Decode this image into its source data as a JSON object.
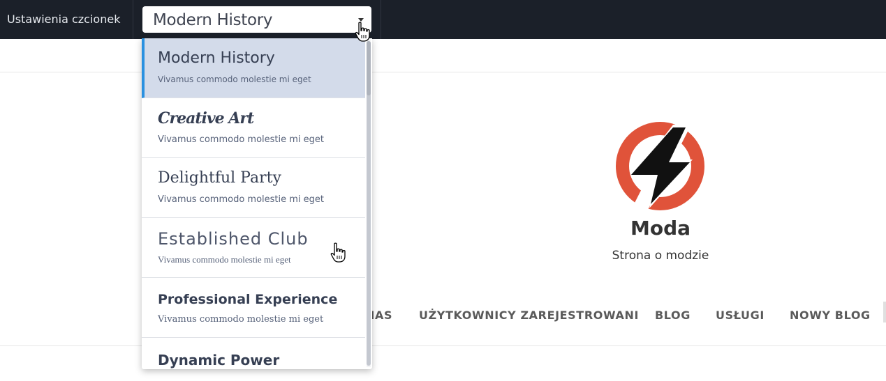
{
  "toolbar": {
    "label": "Ustawienia czcionek",
    "selected_font": "Modern History"
  },
  "dropdown": {
    "options": [
      {
        "title": "Modern History",
        "subtitle": "Vivamus commodo molestie mi eget",
        "selected": true
      },
      {
        "title": "Creative Art",
        "subtitle": "Vivamus commodo molestie mi eget",
        "selected": false
      },
      {
        "title": "Delightful Party",
        "subtitle": "Vivamus commodo molestie mi eget",
        "selected": false
      },
      {
        "title": "Established Club",
        "subtitle": "Vivamus commodo molestie mi eget",
        "selected": false
      },
      {
        "title": "Professional Experience",
        "subtitle": "Vivamus commodo molestie mi eget",
        "selected": false
      },
      {
        "title": "Dynamic Power",
        "subtitle": "",
        "selected": false
      }
    ]
  },
  "site": {
    "name": "Moda",
    "tagline": "Strona o modzie",
    "logo_icon": "lightning-bolt-icon"
  },
  "nav": {
    "partial_item": "NAS",
    "items": [
      "UŻYTKOWNICY ZAREJESTROWANI",
      "BLOG",
      "USŁUGI",
      "NOWY BLOG"
    ]
  },
  "colors": {
    "toolbar_bg": "#1b2029",
    "selected_bg": "#d3dbea",
    "selected_accent": "#2a91e0",
    "logo_red": "#e0533a"
  }
}
